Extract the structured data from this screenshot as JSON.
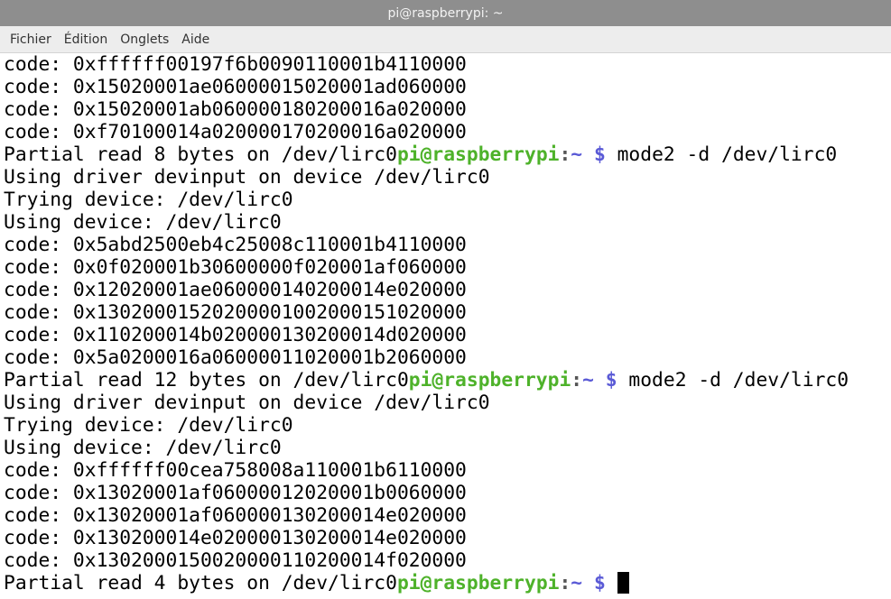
{
  "window": {
    "title": "pi@raspberrypi: ~"
  },
  "menu": {
    "items": [
      {
        "label": "Fichier",
        "name": "menu-file"
      },
      {
        "label": "Édition",
        "name": "menu-edit"
      },
      {
        "label": "Onglets",
        "name": "menu-tabs"
      },
      {
        "label": "Aide",
        "name": "menu-help"
      }
    ]
  },
  "prompt": {
    "user_host": "pi@raspberrypi",
    "sep": ":",
    "path": "~",
    "dollar": "$",
    "user_color": "#4eb22a",
    "path_color": "#5a5ad6"
  },
  "terminal": {
    "lines": [
      {
        "text": "code: 0xffffff00197f6b0090110001b4110000"
      },
      {
        "text": "code: 0x15020001ae06000015020001ad060000"
      },
      {
        "text": "code: 0x15020001ab060000180200016a020000"
      },
      {
        "text": "code: 0xf70100014a020000170200016a020000"
      },
      {
        "text": "Partial read 8 bytes on /dev/lirc0",
        "command": " mode2 -d /dev/lirc0"
      },
      {
        "text": "Using driver devinput on device /dev/lirc0"
      },
      {
        "text": "Trying device: /dev/lirc0"
      },
      {
        "text": "Using device: /dev/lirc0"
      },
      {
        "text": "code: 0x5abd2500eb4c25008c110001b4110000"
      },
      {
        "text": "code: 0x0f020001b30600000f020001af060000"
      },
      {
        "text": "code: 0x12020001ae060000140200014e020000"
      },
      {
        "text": "code: 0x13020001520200001002000151020000"
      },
      {
        "text": "code: 0x110200014b020000130200014d020000"
      },
      {
        "text": "code: 0x5a0200016a06000011020001b2060000"
      },
      {
        "text": "Partial read 12 bytes on /dev/lirc0",
        "command": " mode2 -d /dev/lirc0"
      },
      {
        "text": "Using driver devinput on device /dev/lirc0"
      },
      {
        "text": "Trying device: /dev/lirc0"
      },
      {
        "text": "Using device: /dev/lirc0"
      },
      {
        "text": "code: 0xffffff00cea758008a110001b6110000"
      },
      {
        "text": "code: 0x13020001af06000012020001b0060000"
      },
      {
        "text": "code: 0x13020001af060000130200014e020000"
      },
      {
        "text": "code: 0x130200014e020000130200014e020000"
      },
      {
        "text": "code: 0x1302000150020000110200014f020000"
      },
      {
        "text": "Partial read 4 bytes on /dev/lirc0",
        "command": " ",
        "cursor": true
      }
    ]
  }
}
